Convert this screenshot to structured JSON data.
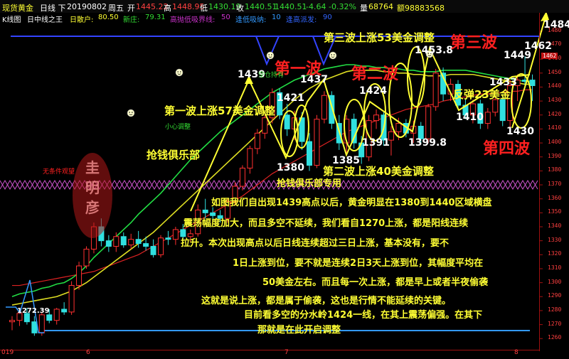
{
  "header": {
    "symbol": "现货黄金",
    "period": "日线 下",
    "date": "20190802",
    "weekday": "周五",
    "open_label": "开",
    "open": "1445.22",
    "high_label": "高",
    "high": "1448.95",
    "low_label": "低",
    "low": "1430.19",
    "close_label": "收",
    "close": "1440.51",
    "last": "1440.51",
    "change": "-4.64",
    "change_pct": "-0.32%",
    "volume_label": "量",
    "volume": "68764",
    "extra": "额98883568"
  },
  "indicator_bar": {
    "name": "K线图",
    "formula": "日中线之王",
    "buy_label": "日散户:",
    "buy_value": "80.50",
    "new_label": "新庄:",
    "new_value": "79.31",
    "limit_label": "高抛低吸界线:",
    "limit_value": "50",
    "follow_label": "逢低吸纳:",
    "follow_value": "10",
    "high_label": "逢高派发:",
    "high_value": "90"
  },
  "axis": {
    "y_labels": [
      "1480",
      "1470",
      "1460",
      "1450",
      "1440",
      "1430",
      "1420",
      "1410",
      "1400",
      "1390",
      "1380",
      "1370",
      "1360",
      "1350",
      "1340",
      "1330",
      "1320",
      "1310",
      "1300",
      "1290",
      "1280",
      "1270",
      "1260"
    ],
    "x_labels": [
      "019",
      "6",
      "7",
      "8"
    ],
    "current_price_tag": "1462"
  },
  "chart_data": {
    "type": "candlestick",
    "ylim": [
      1253,
      1485
    ],
    "candles": [
      {
        "o": 1272,
        "h": 1276,
        "l": 1266,
        "c": 1273
      },
      {
        "o": 1273,
        "h": 1280,
        "l": 1269,
        "c": 1278
      },
      {
        "o": 1278,
        "h": 1282,
        "l": 1270,
        "c": 1272
      },
      {
        "o": 1272,
        "h": 1276,
        "l": 1262,
        "c": 1264
      },
      {
        "o": 1264,
        "h": 1279,
        "l": 1262,
        "c": 1277
      },
      {
        "o": 1277,
        "h": 1281,
        "l": 1271,
        "c": 1273
      },
      {
        "o": 1273,
        "h": 1282,
        "l": 1270,
        "c": 1281
      },
      {
        "o": 1281,
        "h": 1286,
        "l": 1277,
        "c": 1279
      },
      {
        "o": 1279,
        "h": 1301,
        "l": 1277,
        "c": 1298
      },
      {
        "o": 1298,
        "h": 1315,
        "l": 1295,
        "c": 1312
      },
      {
        "o": 1312,
        "h": 1326,
        "l": 1310,
        "c": 1324
      },
      {
        "o": 1324,
        "h": 1343,
        "l": 1321,
        "c": 1340
      },
      {
        "o": 1340,
        "h": 1346,
        "l": 1326,
        "c": 1330
      },
      {
        "o": 1330,
        "h": 1334,
        "l": 1322,
        "c": 1326
      },
      {
        "o": 1326,
        "h": 1336,
        "l": 1322,
        "c": 1333
      },
      {
        "o": 1333,
        "h": 1336,
        "l": 1325,
        "c": 1327
      },
      {
        "o": 1327,
        "h": 1335,
        "l": 1324,
        "c": 1331
      },
      {
        "o": 1331,
        "h": 1337,
        "l": 1325,
        "c": 1328
      },
      {
        "o": 1328,
        "h": 1333,
        "l": 1323,
        "c": 1326
      },
      {
        "o": 1326,
        "h": 1331,
        "l": 1318,
        "c": 1320
      },
      {
        "o": 1320,
        "h": 1334,
        "l": 1318,
        "c": 1332
      },
      {
        "o": 1332,
        "h": 1337,
        "l": 1327,
        "c": 1331
      },
      {
        "o": 1331,
        "h": 1340,
        "l": 1327,
        "c": 1338
      },
      {
        "o": 1338,
        "h": 1342,
        "l": 1330,
        "c": 1333
      },
      {
        "o": 1333,
        "h": 1338,
        "l": 1329,
        "c": 1335
      },
      {
        "o": 1335,
        "h": 1356,
        "l": 1333,
        "c": 1352
      },
      {
        "o": 1352,
        "h": 1360,
        "l": 1346,
        "c": 1350
      },
      {
        "o": 1350,
        "h": 1354,
        "l": 1344,
        "c": 1348
      },
      {
        "o": 1348,
        "h": 1352,
        "l": 1343,
        "c": 1346
      },
      {
        "o": 1346,
        "h": 1360,
        "l": 1343,
        "c": 1358
      },
      {
        "o": 1358,
        "h": 1372,
        "l": 1355,
        "c": 1369
      },
      {
        "o": 1369,
        "h": 1384,
        "l": 1366,
        "c": 1382
      },
      {
        "o": 1382,
        "h": 1398,
        "l": 1378,
        "c": 1396
      },
      {
        "o": 1396,
        "h": 1410,
        "l": 1392,
        "c": 1407
      },
      {
        "o": 1407,
        "h": 1420,
        "l": 1403,
        "c": 1418
      },
      {
        "o": 1418,
        "h": 1439,
        "l": 1414,
        "c": 1436
      },
      {
        "o": 1436,
        "h": 1439,
        "l": 1417,
        "c": 1420
      },
      {
        "o": 1420,
        "h": 1428,
        "l": 1405,
        "c": 1410
      },
      {
        "o": 1410,
        "h": 1423,
        "l": 1402,
        "c": 1418
      },
      {
        "o": 1418,
        "h": 1422,
        "l": 1395,
        "c": 1401
      },
      {
        "o": 1401,
        "h": 1407,
        "l": 1380,
        "c": 1384
      },
      {
        "o": 1384,
        "h": 1420,
        "l": 1382,
        "c": 1417
      },
      {
        "o": 1417,
        "h": 1437,
        "l": 1414,
        "c": 1434
      },
      {
        "o": 1434,
        "h": 1437,
        "l": 1410,
        "c": 1414
      },
      {
        "o": 1414,
        "h": 1420,
        "l": 1395,
        "c": 1400
      },
      {
        "o": 1400,
        "h": 1420,
        "l": 1392,
        "c": 1417
      },
      {
        "o": 1417,
        "h": 1421,
        "l": 1396,
        "c": 1400
      },
      {
        "o": 1400,
        "h": 1405,
        "l": 1385,
        "c": 1390
      },
      {
        "o": 1390,
        "h": 1420,
        "l": 1387,
        "c": 1416
      },
      {
        "o": 1416,
        "h": 1424,
        "l": 1410,
        "c": 1420
      },
      {
        "o": 1420,
        "h": 1422,
        "l": 1398,
        "c": 1402
      },
      {
        "o": 1402,
        "h": 1412,
        "l": 1391,
        "c": 1408
      },
      {
        "o": 1408,
        "h": 1418,
        "l": 1402,
        "c": 1414
      },
      {
        "o": 1414,
        "h": 1417,
        "l": 1404,
        "c": 1407
      },
      {
        "o": 1407,
        "h": 1416,
        "l": 1400,
        "c": 1412
      },
      {
        "o": 1412,
        "h": 1415,
        "l": 1399,
        "c": 1403
      },
      {
        "o": 1403,
        "h": 1428,
        "l": 1400,
        "c": 1426
      },
      {
        "o": 1426,
        "h": 1453,
        "l": 1423,
        "c": 1450
      },
      {
        "o": 1450,
        "h": 1454,
        "l": 1430,
        "c": 1435
      },
      {
        "o": 1435,
        "h": 1446,
        "l": 1430,
        "c": 1442
      },
      {
        "o": 1442,
        "h": 1445,
        "l": 1424,
        "c": 1427
      },
      {
        "o": 1427,
        "h": 1432,
        "l": 1417,
        "c": 1420
      },
      {
        "o": 1420,
        "h": 1431,
        "l": 1414,
        "c": 1428
      },
      {
        "o": 1428,
        "h": 1431,
        "l": 1410,
        "c": 1414
      },
      {
        "o": 1414,
        "h": 1425,
        "l": 1410,
        "c": 1422
      },
      {
        "o": 1422,
        "h": 1434,
        "l": 1419,
        "c": 1431
      },
      {
        "o": 1431,
        "h": 1435,
        "l": 1412,
        "c": 1416
      },
      {
        "o": 1416,
        "h": 1445,
        "l": 1410,
        "c": 1441
      },
      {
        "o": 1441,
        "h": 1449,
        "l": 1430,
        "c": 1445
      },
      {
        "o": 1445,
        "h": 1462,
        "l": 1439,
        "c": 1444
      },
      {
        "o": 1445,
        "h": 1449,
        "l": 1430,
        "c": 1441
      }
    ],
    "ma_green": [
      1290,
      1292,
      1293,
      1294,
      1296,
      1297,
      1299,
      1300,
      1303,
      1307,
      1312,
      1318,
      1323,
      1328,
      1333,
      1338,
      1343,
      1349,
      1354,
      1359,
      1364,
      1370,
      1376,
      1382,
      1388,
      1393,
      1398,
      1403,
      1408,
      1412,
      1416,
      1420,
      1424,
      1428,
      1432,
      1436,
      1439,
      1442,
      1445,
      1447,
      1449,
      1451,
      1453,
      1454,
      1455,
      1456,
      1456,
      1455,
      1455,
      1454,
      1454,
      1453,
      1453,
      1452,
      1452,
      1451,
      1451,
      1451,
      1452,
      1452,
      1452,
      1452,
      1451,
      1450,
      1449,
      1448,
      1447,
      1446,
      1445,
      1444,
      1444
    ],
    "ma_yellow": [
      1284,
      1285,
      1286,
      1287,
      1288,
      1289,
      1290,
      1292,
      1294,
      1297,
      1300,
      1304,
      1308,
      1312,
      1316,
      1320,
      1324,
      1328,
      1332,
      1336,
      1341,
      1346,
      1351,
      1356,
      1361,
      1366,
      1371,
      1376,
      1381,
      1386,
      1391,
      1396,
      1401,
      1406,
      1411,
      1416,
      1421,
      1426,
      1431,
      1435,
      1439,
      1442,
      1445,
      1447,
      1449,
      1451,
      1452,
      1452,
      1452,
      1452,
      1451,
      1451,
      1450,
      1450,
      1449,
      1449,
      1448,
      1448,
      1448,
      1449,
      1449,
      1449,
      1449,
      1448,
      1447,
      1446,
      1445,
      1444,
      1443,
      1442,
      1442
    ],
    "ma_red": [
      1298,
      1298,
      1299,
      1300,
      1301,
      1302,
      1303,
      1304,
      1305,
      1306,
      1307,
      1308,
      1310,
      1312,
      1314,
      1316,
      1318,
      1320,
      1323,
      1326,
      1329,
      1332,
      1335,
      1338,
      1341,
      1344,
      1347,
      1350,
      1353,
      1356,
      1359,
      1362,
      1366,
      1370,
      1374,
      1378,
      1381,
      1384,
      1387,
      1390,
      1393,
      1396,
      1399,
      1402,
      1405,
      1408,
      1410,
      1412,
      1414,
      1416,
      1418,
      1420,
      1422,
      1424,
      1425,
      1426,
      1427,
      1428,
      1430,
      1431,
      1432,
      1433,
      1434,
      1435,
      1435,
      1436,
      1436,
      1437,
      1437,
      1438,
      1438
    ],
    "annotations": [
      {
        "text": "1439",
        "color": "#ffffff"
      },
      {
        "text": "1421",
        "color": "#ffffff"
      },
      {
        "text": "1437",
        "color": "#ffffff"
      },
      {
        "text": "1424",
        "color": "#ffffff"
      },
      {
        "text": "1380",
        "color": "#ffffff"
      },
      {
        "text": "1385",
        "color": "#ffffff"
      },
      {
        "text": "1391",
        "color": "#ffffff"
      },
      {
        "text": "1399.8",
        "color": "#ffffff"
      },
      {
        "text": "1453.8",
        "color": "#ffffff"
      },
      {
        "text": "1410",
        "color": "#ffffff"
      },
      {
        "text": "1433",
        "color": "#ffffff"
      },
      {
        "text": "1449",
        "color": "#ffffff"
      },
      {
        "text": "1430",
        "color": "#ffffff"
      },
      {
        "text": "1462",
        "color": "#ffffff"
      },
      {
        "text": "1484",
        "color": "#ffffff"
      },
      {
        "text": "1272.39",
        "color": "#ffffff"
      },
      {
        "text": "第一波",
        "color": "#ff2020"
      },
      {
        "text": "第二波",
        "color": "#ff2020"
      },
      {
        "text": "第三波",
        "color": "#ff2020"
      },
      {
        "text": "第四波",
        "color": "#ff2020"
      },
      {
        "text": "第三波上涨53美金调整",
        "color": "#ffff33"
      },
      {
        "text": "第一波上涨57美金调整",
        "color": "#ffff33"
      },
      {
        "text": "第二波上涨40美金调整",
        "color": "#ffff33"
      },
      {
        "text": "反弹23美金",
        "color": "#ffff33"
      },
      {
        "text": "抢钱俱乐部",
        "color": "#ffff33"
      },
      {
        "text": "抢钱俱乐部专用",
        "color": "#ffff33"
      },
      {
        "text": "空仓持有",
        "color": "#33dd33"
      },
      {
        "text": "小心调整",
        "color": "#33dd33"
      },
      {
        "text": "无条件观望",
        "color": "#ff2020"
      }
    ]
  },
  "watermark": {
    "text": "圭明彦"
  },
  "note_lines": [
    "如图我们自出现1439高点以后，黄金明显在1380到1440区域横盘",
    "震荡幅度加大，而且多空不延续，我们看自1270上涨，都是阳线连续",
    "拉升。本次出现高点以后日线连续超过三日上涨，基本没有，要不",
    "1日上涨到位，要不就是连续2日3天上涨到位，其幅度平均在",
    "50美金左右。而且每一次上涨，都是早上或者半夜偷袭",
    "这就是说上涨，都是属于偷袭，这也是行情不能延续的关键。",
    "目前看多空的分水岭1424一线，在其上震荡偏强。在其下",
    "那就是在此开启调整"
  ]
}
